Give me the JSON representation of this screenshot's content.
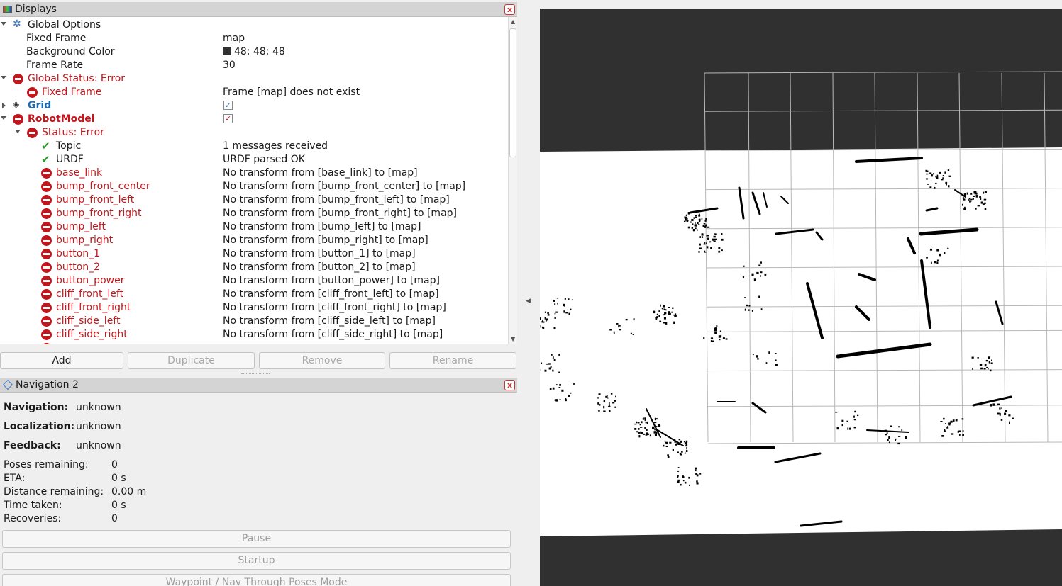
{
  "displays": {
    "title": "Displays",
    "close": "x",
    "rows": [
      {
        "name": "Global Options",
        "value": ""
      },
      {
        "name": "Fixed Frame",
        "value": "map"
      },
      {
        "name": "Background Color",
        "value": "48; 48; 48"
      },
      {
        "name": "Frame Rate",
        "value": "30"
      },
      {
        "name": "Global Status: Error",
        "value": ""
      },
      {
        "name": "Fixed Frame",
        "value": "Frame [map] does not exist"
      },
      {
        "name": "Grid",
        "value": "checked"
      },
      {
        "name": "RobotModel",
        "value": "checked"
      },
      {
        "name": "Status: Error",
        "value": ""
      },
      {
        "name": "Topic",
        "value": "1 messages received"
      },
      {
        "name": "URDF",
        "value": "URDF parsed OK"
      },
      {
        "name": "base_link",
        "value": "No transform from [base_link] to [map]"
      },
      {
        "name": "bump_front_center",
        "value": "No transform from [bump_front_center] to [map]"
      },
      {
        "name": "bump_front_left",
        "value": "No transform from [bump_front_left] to [map]"
      },
      {
        "name": "bump_front_right",
        "value": "No transform from [bump_front_right] to [map]"
      },
      {
        "name": "bump_left",
        "value": "No transform from [bump_left] to [map]"
      },
      {
        "name": "bump_right",
        "value": "No transform from [bump_right] to [map]"
      },
      {
        "name": "button_1",
        "value": "No transform from [button_1] to [map]"
      },
      {
        "name": "button_2",
        "value": "No transform from [button_2] to [map]"
      },
      {
        "name": "button_power",
        "value": "No transform from [button_power] to [map]"
      },
      {
        "name": "cliff_front_left",
        "value": "No transform from [cliff_front_left] to [map]"
      },
      {
        "name": "cliff_front_right",
        "value": "No transform from [cliff_front_right] to [map]"
      },
      {
        "name": "cliff_side_left",
        "value": "No transform from [cliff_side_left] to [map]"
      },
      {
        "name": "cliff_side_right",
        "value": "No transform from [cliff_side_right] to [map]"
      }
    ],
    "buttons": {
      "add": "Add",
      "duplicate": "Duplicate",
      "remove": "Remove",
      "rename": "Rename"
    }
  },
  "navigation": {
    "title": "Navigation 2",
    "close": "x",
    "status": [
      {
        "label": "Navigation:",
        "value": "unknown"
      },
      {
        "label": "Localization:",
        "value": "unknown"
      },
      {
        "label": "Feedback:",
        "value": "unknown"
      }
    ],
    "metrics": [
      {
        "label": "Poses remaining:",
        "value": "0"
      },
      {
        "label": "ETA:",
        "value": "0 s"
      },
      {
        "label": "Distance remaining:",
        "value": "0.00 m"
      },
      {
        "label": "Time taken:",
        "value": "0 s"
      },
      {
        "label": "Recoveries:",
        "value": "0"
      }
    ],
    "buttons": {
      "pause": "Pause",
      "startup": "Startup",
      "waypoint": "Waypoint / Nav Through Poses Mode"
    }
  },
  "colors": {
    "background": "#303030",
    "error": "#c1161b",
    "ok": "#2a9a2a",
    "grid_link": "#1d6bb5"
  }
}
